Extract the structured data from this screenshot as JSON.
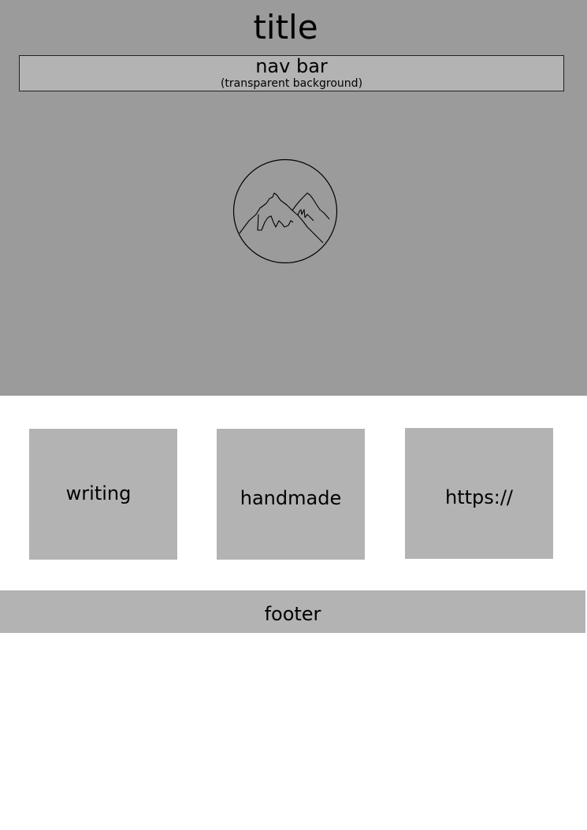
{
  "header": {
    "title": "title",
    "nav": {
      "label": "nav bar",
      "note": "(transparent background)"
    },
    "logo_icon": "mountain-icon"
  },
  "cards": [
    {
      "label": "writing"
    },
    {
      "label": "handmade"
    },
    {
      "label": "https://"
    }
  ],
  "footer": {
    "label": "footer"
  },
  "colors": {
    "hero_background": "#9b9b9b",
    "box_fill": "#b3b3b3",
    "page_background": "#ffffff"
  }
}
